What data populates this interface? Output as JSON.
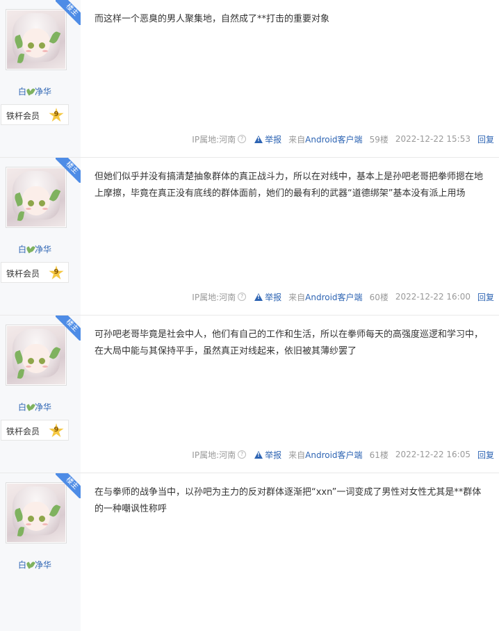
{
  "posts": [
    {
      "badge": "楼主",
      "user": {
        "name_a": "白",
        "name_b": "净华"
      },
      "level": {
        "name": "铁杆会员",
        "num": "9"
      },
      "content": "而这样一个恶臭的男人聚集地，自然成了**打击的重要对象",
      "tail": {
        "ip": "IP属地:河南",
        "report": "举报",
        "from_prefix": "来自",
        "from_client": "Android客户端",
        "floor": "59楼",
        "time": "2022-12-22 15:53",
        "reply": "回复"
      }
    },
    {
      "badge": "楼主",
      "user": {
        "name_a": "白",
        "name_b": "净华"
      },
      "level": {
        "name": "铁杆会员",
        "num": "9"
      },
      "content": "但她们似乎并没有搞清楚抽象群体的真正战斗力，所以在对线中，基本上是孙吧老哥把拳师摁在地上摩擦，毕竟在真正没有底线的群体面前，她们的最有利的武器“道德绑架”基本没有派上用场",
      "tail": {
        "ip": "IP属地:河南",
        "report": "举报",
        "from_prefix": "来自",
        "from_client": "Android客户端",
        "floor": "60楼",
        "time": "2022-12-22 16:00",
        "reply": "回复"
      }
    },
    {
      "badge": "楼主",
      "user": {
        "name_a": "白",
        "name_b": "净华"
      },
      "level": {
        "name": "铁杆会员",
        "num": "9"
      },
      "content": "可孙吧老哥毕竟是社会中人，他们有自己的工作和生活，所以在拳师每天的高强度巡逻和学习中，在大局中能与其保持平手，虽然真正对线起来，依旧被其薄纱罢了",
      "tail": {
        "ip": "IP属地:河南",
        "report": "举报",
        "from_prefix": "来自",
        "from_client": "Android客户端",
        "floor": "61楼",
        "time": "2022-12-22 16:05",
        "reply": "回复"
      }
    },
    {
      "badge": "楼主",
      "user": {
        "name_a": "白",
        "name_b": "净华"
      },
      "level": {
        "name": "",
        "num": ""
      },
      "content": "在与拳师的战争当中，以孙吧为主力的反对群体逐渐把“xxn”一词变成了男性对女性尤其是**群体的一种嘲讽性称呼",
      "tail": null
    }
  ],
  "icons": {
    "help": "question-circle-icon",
    "report": "warning-triangle-icon",
    "badge": "corner-ribbon",
    "level": "star-icon"
  },
  "colors": {
    "link": "#2d64b3",
    "badge": "#4e8ce6",
    "sidebar": "#f7f8fa",
    "star": "#f5c842"
  }
}
